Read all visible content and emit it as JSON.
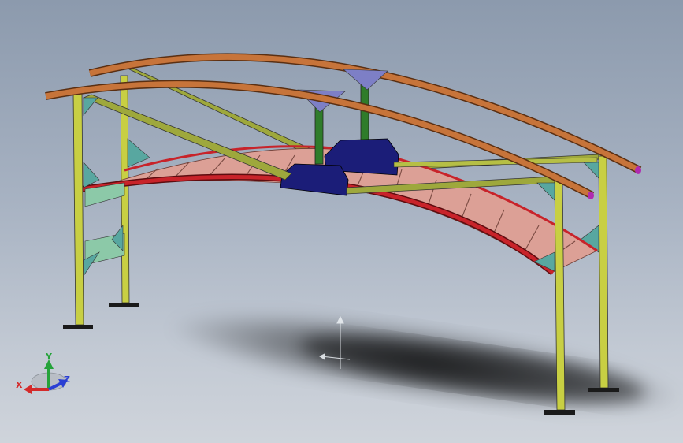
{
  "triad": {
    "x_label": "X",
    "y_label": "Y",
    "z_label": "Z"
  },
  "colors": {
    "background_top": "#8c9aad",
    "background_bottom": "#cfd4db",
    "handrail": "#c7743a",
    "handrail_end": "#b02ab0",
    "post": "#c8cf43",
    "brace_diagonal": "#9ea83c",
    "side_panel": "#8cc9a8",
    "gusset": "#58a7a0",
    "deck": "#dca096",
    "deck_edge": "#c8232a",
    "center_post": "#2f7c2a",
    "hanger_bracket": "#7d7fc6",
    "center_base": "#1b1d78",
    "axis_x": "#d42a2a",
    "axis_y": "#25a33a",
    "axis_z": "#2a3fd4"
  }
}
